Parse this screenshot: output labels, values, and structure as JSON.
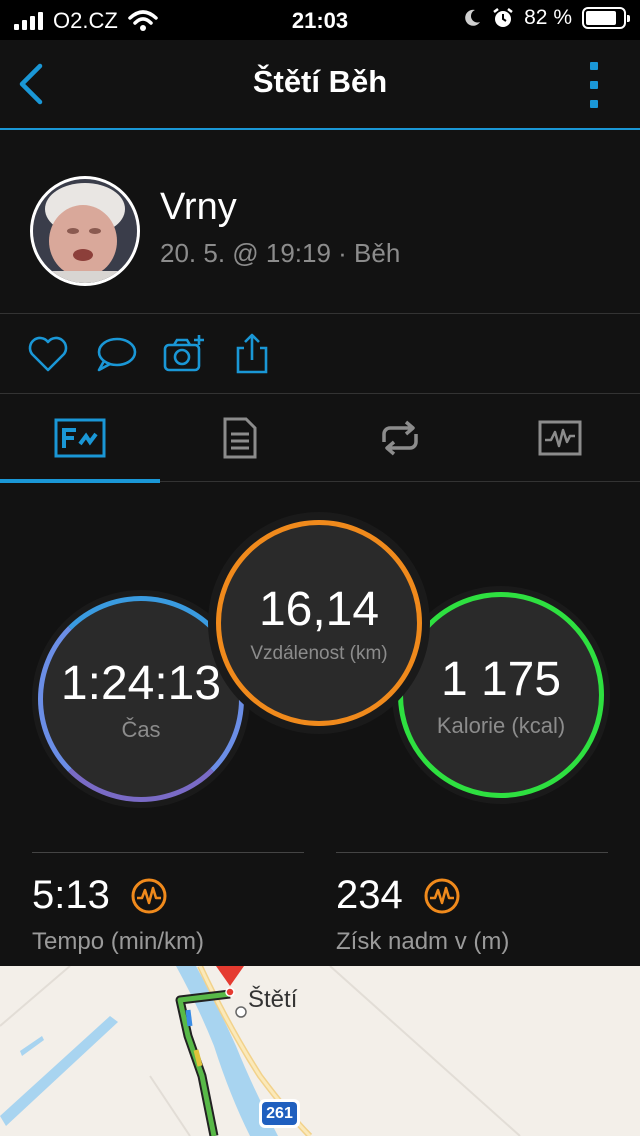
{
  "status_bar": {
    "carrier": "O2.CZ",
    "time": "21:03",
    "battery": "82 %",
    "battery_level": 0.82
  },
  "nav": {
    "title": "Štětí Běh"
  },
  "profile": {
    "name": "Vrny",
    "meta": "20. 5. @ 19:19 · Běh"
  },
  "actions": [
    "heart-icon",
    "comment-icon",
    "camera-add-icon",
    "share-icon"
  ],
  "tabs": [
    {
      "icon": "stats-card-icon",
      "active": true
    },
    {
      "icon": "document-icon",
      "active": false
    },
    {
      "icon": "repeat-icon",
      "active": false
    },
    {
      "icon": "activity-chart-icon",
      "active": false
    }
  ],
  "circles": {
    "time": {
      "value": "1:24:13",
      "label": "Čas",
      "color": "#6b8ee6"
    },
    "distance": {
      "value": "16,14",
      "label": "Vzdálenost (km)",
      "color": "#f08a1c"
    },
    "calories": {
      "value": "1 175",
      "label": "Kalorie (kcal)",
      "color": "#2ee040"
    }
  },
  "stats": {
    "pace": {
      "value": "5:13",
      "label": "Tempo (min/km)"
    },
    "elevation": {
      "value": "234",
      "label": "Získ nadm v (m)"
    }
  },
  "map": {
    "town": "Štětí",
    "road": "261"
  },
  "colors": {
    "accent": "#1a97d6",
    "gauge_orange": "#f08a1c"
  }
}
